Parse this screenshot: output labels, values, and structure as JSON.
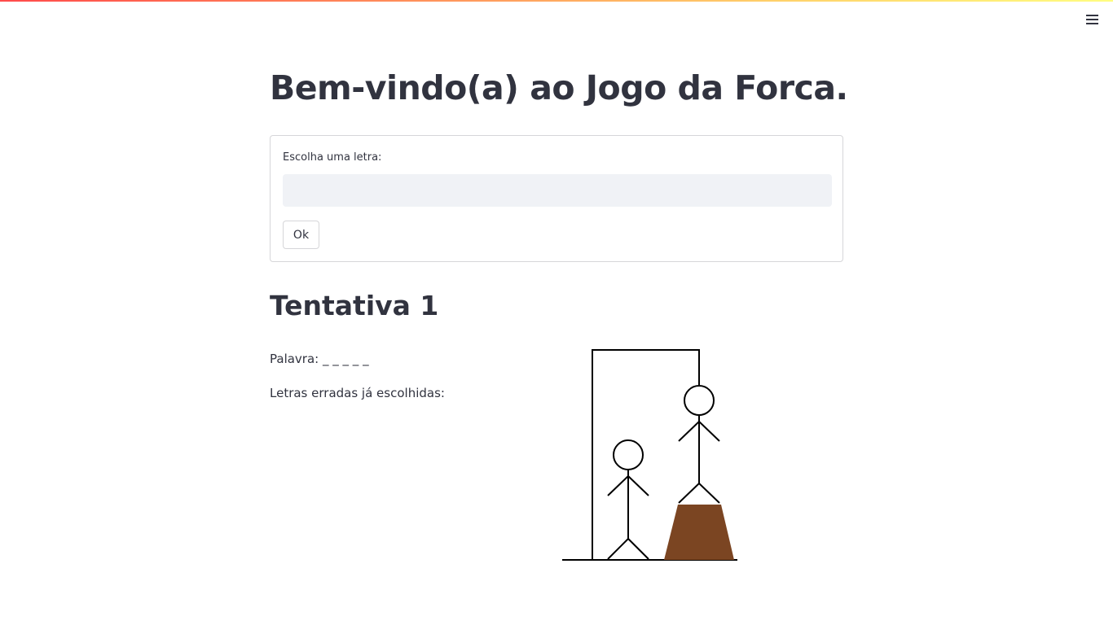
{
  "app": {
    "title": "Bem-vindo(a) ao Jogo da Forca."
  },
  "form": {
    "label": "Escolha uma letra:",
    "input_value": "",
    "input_placeholder": "",
    "submit_label": "Ok"
  },
  "game": {
    "attempt_title": "Tentativa 1",
    "word_label": "Palavra:",
    "word_mask": "_ _ _ _ _",
    "wrong_letters_label": "Letras erradas já escolhidas:",
    "wrong_letters": ""
  },
  "colors": {
    "text": "#31333f",
    "input_bg": "#f0f2f6",
    "stool": "#7b4522",
    "accent_gradient_start": "#ff4b4b",
    "accent_gradient_end": "#fffd80"
  },
  "icons": {
    "menu": "hamburger-menu-icon"
  }
}
